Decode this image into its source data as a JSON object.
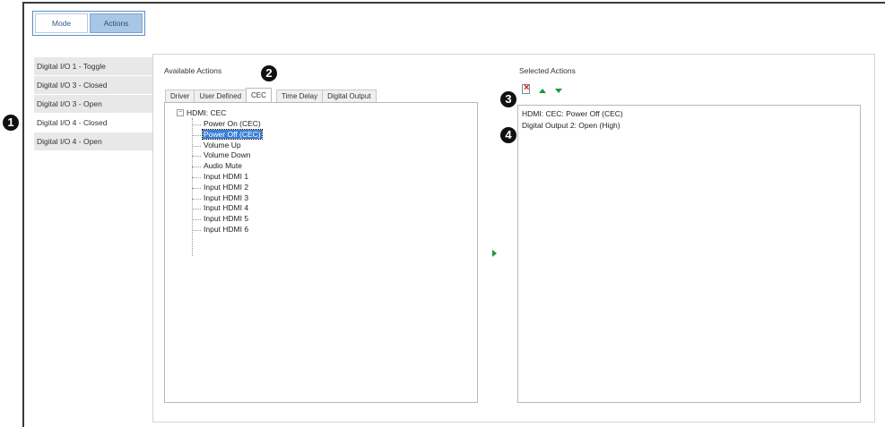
{
  "mode_tabs": {
    "mode": "Mode",
    "actions": "Actions"
  },
  "triggers": [
    {
      "label": "Digital I/O 1 - Toggle"
    },
    {
      "label": "Digital I/O 3 - Closed"
    },
    {
      "label": "Digital I/O 3 - Open"
    },
    {
      "label": "Digital I/O 4 - Closed"
    },
    {
      "label": "Digital I/O 4 - Open"
    }
  ],
  "available": {
    "title": "Available Actions",
    "tabs": [
      "Driver",
      "User Defined",
      "CEC",
      "Time Delay",
      "Digital Output"
    ],
    "tree_root": "HDMI: CEC",
    "expander": "−",
    "items": [
      "Power On (CEC)",
      "Power Off (CEC)",
      "Volume Up",
      "Volume Down",
      "Audio Mute",
      "Input HDMI 1",
      "Input HDMI 2",
      "Input HDMI 3",
      "Input HDMI 4",
      "Input HDMI 5",
      "Input HDMI 6"
    ]
  },
  "selected": {
    "title": "Selected Actions",
    "items": [
      "HDMI: CEC: Power Off (CEC)",
      "Digital Output 2: Open (High)"
    ]
  },
  "callouts": [
    "1",
    "2",
    "3",
    "4"
  ],
  "icons": {
    "delete": "delete-icon",
    "move_up": "move-up-icon",
    "move_down": "move-down-icon",
    "add": "add-arrow-icon"
  },
  "colors": {
    "accent": "#5b8ec9",
    "active_tab": "#a9c6e6",
    "arrow_green": "#1a9a3a",
    "selection": "#3b7fd6"
  }
}
